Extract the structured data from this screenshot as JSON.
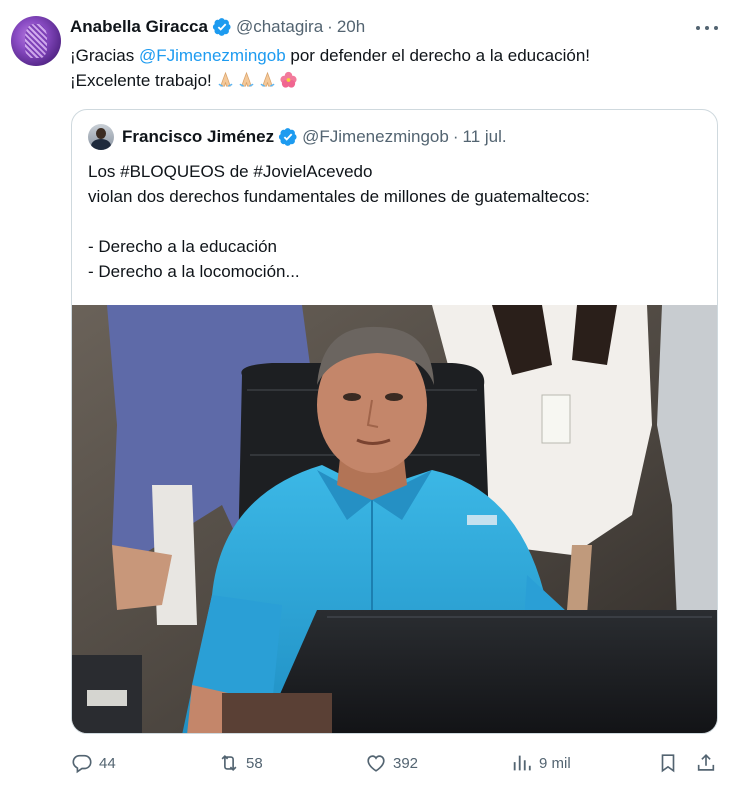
{
  "tweet": {
    "author_name": "Anabella Giracca",
    "author_handle": "@chatagira",
    "separator": "·",
    "time": "20h",
    "text_part1": "¡Gracias ",
    "mention": "@FJimenezmingob",
    "text_part2": " por defender el derecho a la educación!",
    "text_line2": "¡Excelente trabajo!",
    "emojis": [
      "folded-hands-emoji",
      "folded-hands-emoji",
      "folded-hands-emoji",
      "hibiscus-emoji"
    ]
  },
  "quote": {
    "author_name": "Francisco Jiménez",
    "author_handle": "@FJimenezmingob",
    "separator": "·",
    "date": "11 jul.",
    "text": "Los #BLOQUEOS de #JovielAcevedo\nviolan dos derechos fundamentales de millones de guatemaltecos:\n\n- Derecho a la educación\n- Derecho a la locomoción..."
  },
  "actions": {
    "replies": "44",
    "reposts": "58",
    "likes": "392",
    "views": "9 mil"
  },
  "colors": {
    "accent": "#1d9bf0",
    "secondary_text": "#536471",
    "border": "#cfd9de",
    "shirt": "#2fa8d8"
  },
  "icons": [
    "verified-badge-icon",
    "more-icon",
    "reply-icon",
    "repost-icon",
    "like-icon",
    "views-icon",
    "bookmark-icon",
    "share-icon"
  ]
}
